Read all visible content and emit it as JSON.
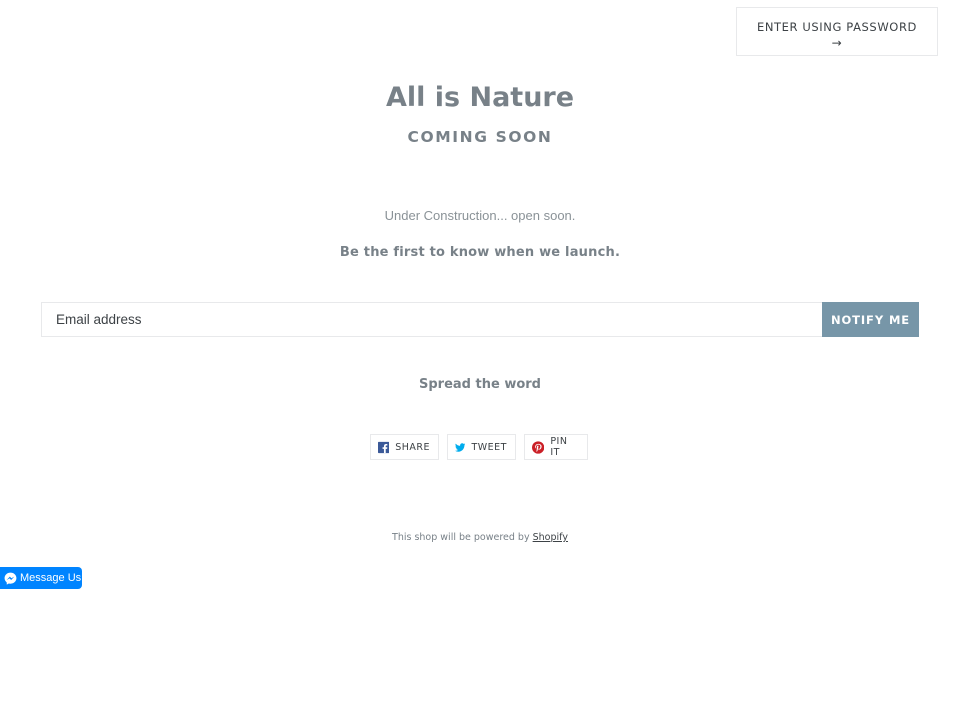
{
  "header": {
    "password_label": "ENTER USING PASSWORD",
    "password_arrow": "→"
  },
  "main": {
    "title": "All is Nature",
    "subtitle": "COMING SOON",
    "message": "Under Construction... open soon.",
    "launch_text": "Be the first to know when we launch."
  },
  "signup": {
    "email_placeholder": "Email address",
    "notify_label": "NOTIFY ME"
  },
  "share": {
    "heading": "Spread the word",
    "buttons": [
      {
        "label": "SHARE",
        "icon": "facebook-icon",
        "color": "#3b5998"
      },
      {
        "label": "TWEET",
        "icon": "twitter-icon",
        "color": "#00aced"
      },
      {
        "label": "PIN IT",
        "icon": "pinterest-icon",
        "color": "#cb2027"
      }
    ]
  },
  "footer": {
    "powered_text": "This shop will be powered by",
    "powered_link": "Shopify"
  },
  "messenger": {
    "label": "Message Us",
    "icon": "messenger-icon",
    "color": "#0084ff"
  }
}
